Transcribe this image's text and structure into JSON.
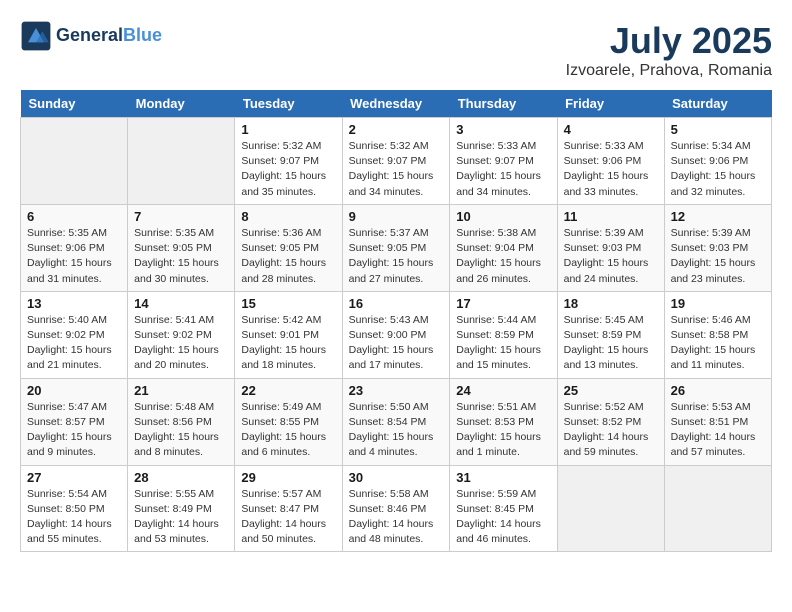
{
  "header": {
    "logo_line1": "General",
    "logo_line2": "Blue",
    "month": "July 2025",
    "location": "Izvoarele, Prahova, Romania"
  },
  "days_of_week": [
    "Sunday",
    "Monday",
    "Tuesday",
    "Wednesday",
    "Thursday",
    "Friday",
    "Saturday"
  ],
  "weeks": [
    [
      {
        "day": "",
        "detail": ""
      },
      {
        "day": "",
        "detail": ""
      },
      {
        "day": "1",
        "detail": "Sunrise: 5:32 AM\nSunset: 9:07 PM\nDaylight: 15 hours and 35 minutes."
      },
      {
        "day": "2",
        "detail": "Sunrise: 5:32 AM\nSunset: 9:07 PM\nDaylight: 15 hours and 34 minutes."
      },
      {
        "day": "3",
        "detail": "Sunrise: 5:33 AM\nSunset: 9:07 PM\nDaylight: 15 hours and 34 minutes."
      },
      {
        "day": "4",
        "detail": "Sunrise: 5:33 AM\nSunset: 9:06 PM\nDaylight: 15 hours and 33 minutes."
      },
      {
        "day": "5",
        "detail": "Sunrise: 5:34 AM\nSunset: 9:06 PM\nDaylight: 15 hours and 32 minutes."
      }
    ],
    [
      {
        "day": "6",
        "detail": "Sunrise: 5:35 AM\nSunset: 9:06 PM\nDaylight: 15 hours and 31 minutes."
      },
      {
        "day": "7",
        "detail": "Sunrise: 5:35 AM\nSunset: 9:05 PM\nDaylight: 15 hours and 30 minutes."
      },
      {
        "day": "8",
        "detail": "Sunrise: 5:36 AM\nSunset: 9:05 PM\nDaylight: 15 hours and 28 minutes."
      },
      {
        "day": "9",
        "detail": "Sunrise: 5:37 AM\nSunset: 9:05 PM\nDaylight: 15 hours and 27 minutes."
      },
      {
        "day": "10",
        "detail": "Sunrise: 5:38 AM\nSunset: 9:04 PM\nDaylight: 15 hours and 26 minutes."
      },
      {
        "day": "11",
        "detail": "Sunrise: 5:39 AM\nSunset: 9:03 PM\nDaylight: 15 hours and 24 minutes."
      },
      {
        "day": "12",
        "detail": "Sunrise: 5:39 AM\nSunset: 9:03 PM\nDaylight: 15 hours and 23 minutes."
      }
    ],
    [
      {
        "day": "13",
        "detail": "Sunrise: 5:40 AM\nSunset: 9:02 PM\nDaylight: 15 hours and 21 minutes."
      },
      {
        "day": "14",
        "detail": "Sunrise: 5:41 AM\nSunset: 9:02 PM\nDaylight: 15 hours and 20 minutes."
      },
      {
        "day": "15",
        "detail": "Sunrise: 5:42 AM\nSunset: 9:01 PM\nDaylight: 15 hours and 18 minutes."
      },
      {
        "day": "16",
        "detail": "Sunrise: 5:43 AM\nSunset: 9:00 PM\nDaylight: 15 hours and 17 minutes."
      },
      {
        "day": "17",
        "detail": "Sunrise: 5:44 AM\nSunset: 8:59 PM\nDaylight: 15 hours and 15 minutes."
      },
      {
        "day": "18",
        "detail": "Sunrise: 5:45 AM\nSunset: 8:59 PM\nDaylight: 15 hours and 13 minutes."
      },
      {
        "day": "19",
        "detail": "Sunrise: 5:46 AM\nSunset: 8:58 PM\nDaylight: 15 hours and 11 minutes."
      }
    ],
    [
      {
        "day": "20",
        "detail": "Sunrise: 5:47 AM\nSunset: 8:57 PM\nDaylight: 15 hours and 9 minutes."
      },
      {
        "day": "21",
        "detail": "Sunrise: 5:48 AM\nSunset: 8:56 PM\nDaylight: 15 hours and 8 minutes."
      },
      {
        "day": "22",
        "detail": "Sunrise: 5:49 AM\nSunset: 8:55 PM\nDaylight: 15 hours and 6 minutes."
      },
      {
        "day": "23",
        "detail": "Sunrise: 5:50 AM\nSunset: 8:54 PM\nDaylight: 15 hours and 4 minutes."
      },
      {
        "day": "24",
        "detail": "Sunrise: 5:51 AM\nSunset: 8:53 PM\nDaylight: 15 hours and 1 minute."
      },
      {
        "day": "25",
        "detail": "Sunrise: 5:52 AM\nSunset: 8:52 PM\nDaylight: 14 hours and 59 minutes."
      },
      {
        "day": "26",
        "detail": "Sunrise: 5:53 AM\nSunset: 8:51 PM\nDaylight: 14 hours and 57 minutes."
      }
    ],
    [
      {
        "day": "27",
        "detail": "Sunrise: 5:54 AM\nSunset: 8:50 PM\nDaylight: 14 hours and 55 minutes."
      },
      {
        "day": "28",
        "detail": "Sunrise: 5:55 AM\nSunset: 8:49 PM\nDaylight: 14 hours and 53 minutes."
      },
      {
        "day": "29",
        "detail": "Sunrise: 5:57 AM\nSunset: 8:47 PM\nDaylight: 14 hours and 50 minutes."
      },
      {
        "day": "30",
        "detail": "Sunrise: 5:58 AM\nSunset: 8:46 PM\nDaylight: 14 hours and 48 minutes."
      },
      {
        "day": "31",
        "detail": "Sunrise: 5:59 AM\nSunset: 8:45 PM\nDaylight: 14 hours and 46 minutes."
      },
      {
        "day": "",
        "detail": ""
      },
      {
        "day": "",
        "detail": ""
      }
    ]
  ]
}
